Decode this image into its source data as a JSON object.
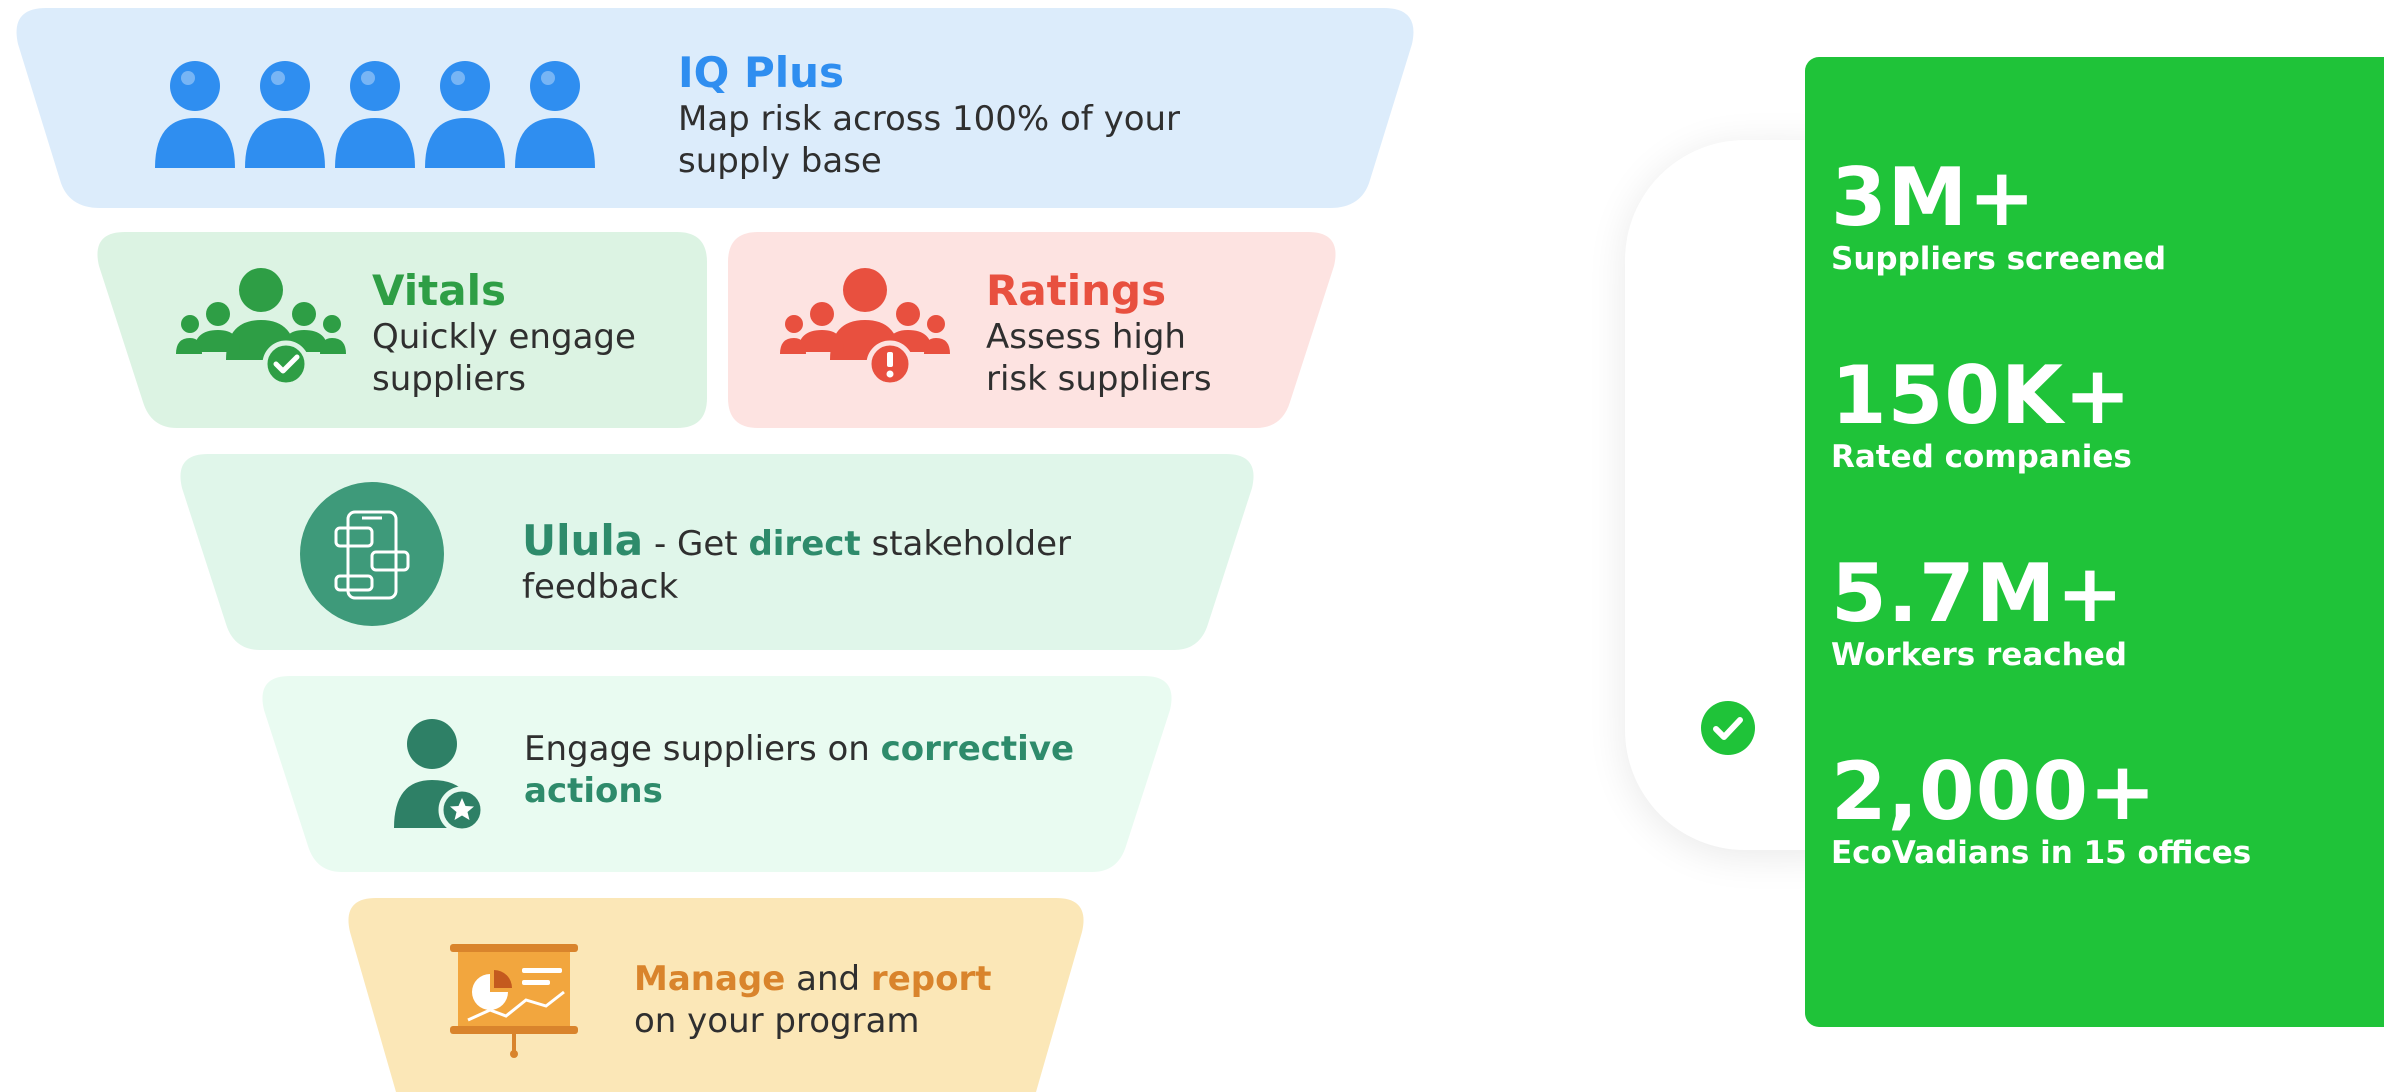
{
  "funnel": {
    "iq_plus": {
      "title": "IQ Plus",
      "desc_line1": "Map risk across 100% of your",
      "desc_line2": "supply base",
      "color": "#2f8ef0"
    },
    "vitals": {
      "title": "Vitals",
      "desc_line1": "Quickly engage",
      "desc_line2": "suppliers",
      "color": "#2e9e45"
    },
    "ratings": {
      "title": "Ratings",
      "desc_line1": "Assess high",
      "desc_line2": "risk suppliers",
      "color": "#e8503f"
    },
    "ulula": {
      "title": "Ulula",
      "text_before": " - Get ",
      "bold": "direct",
      "text_after": " stakeholder",
      "desc_line2": "feedback",
      "color": "#2e8b6b"
    },
    "corrective": {
      "text_before": "Engage suppliers on ",
      "bold1": "corrective",
      "bold2": "actions",
      "color": "#2e8b6b"
    },
    "manage": {
      "bold1": "Manage",
      "text_mid": " and ",
      "bold2": "report",
      "desc_line2": "on your program",
      "color": "#d9842c"
    }
  },
  "stats": [
    {
      "value": "3M+",
      "label": "Suppliers screened"
    },
    {
      "value": "150K+",
      "label": "Rated companies"
    },
    {
      "value": "5.7M+",
      "label": "Workers reached"
    },
    {
      "value": "2,000+",
      "label": "EcoVadians in 15 offices"
    }
  ],
  "colors": {
    "panel_green": "#1fc339",
    "tier_blue": "#dcecfb",
    "tier_green": "#dcf3e3",
    "tier_red": "#fde3e1",
    "tier_teal": "#e0f6ea",
    "tier_mint": "#e9fbf1",
    "tier_orange": "#fbe7b7"
  }
}
